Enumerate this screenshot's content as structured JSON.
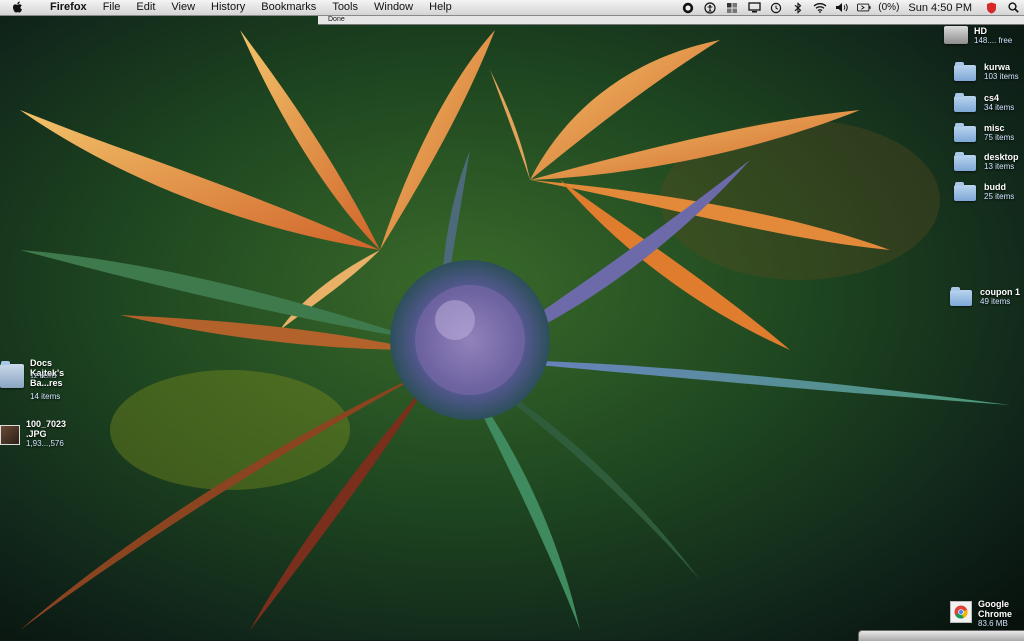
{
  "menubar": {
    "app_name": "Firefox",
    "menus": [
      "File",
      "Edit",
      "View",
      "History",
      "Bookmarks",
      "Tools",
      "Window",
      "Help"
    ],
    "battery_percent": "(0%)",
    "clock": "Sun 4:50 PM"
  },
  "firefox_status": "Done",
  "desktop": {
    "drive": {
      "name": "HD",
      "info": "148.... free"
    },
    "folders": [
      {
        "name": "kurwa",
        "count": "103 items"
      },
      {
        "name": "cs4",
        "count": "34 items"
      },
      {
        "name": "misc",
        "count": "75 items"
      },
      {
        "name": "desktop",
        "count": "13 items"
      },
      {
        "name": "budd",
        "count": "25 items"
      },
      {
        "name": "coupon 1",
        "count": "49 items"
      }
    ],
    "docs": {
      "line1": "Docs",
      "line2": "Kajtek's",
      "line3": "Ba...res",
      "overlap": "12 items",
      "count": "14 items"
    },
    "image_file": {
      "name": "100_7023",
      "ext": ".JPG",
      "info": "1,93...,576"
    },
    "chrome": {
      "line1": "Google",
      "line2": "Chrome",
      "size": "83.6 MB"
    }
  },
  "colors": {
    "menubar_bg": "#e6e6e6",
    "folder_blue": "#8fb6e0"
  }
}
